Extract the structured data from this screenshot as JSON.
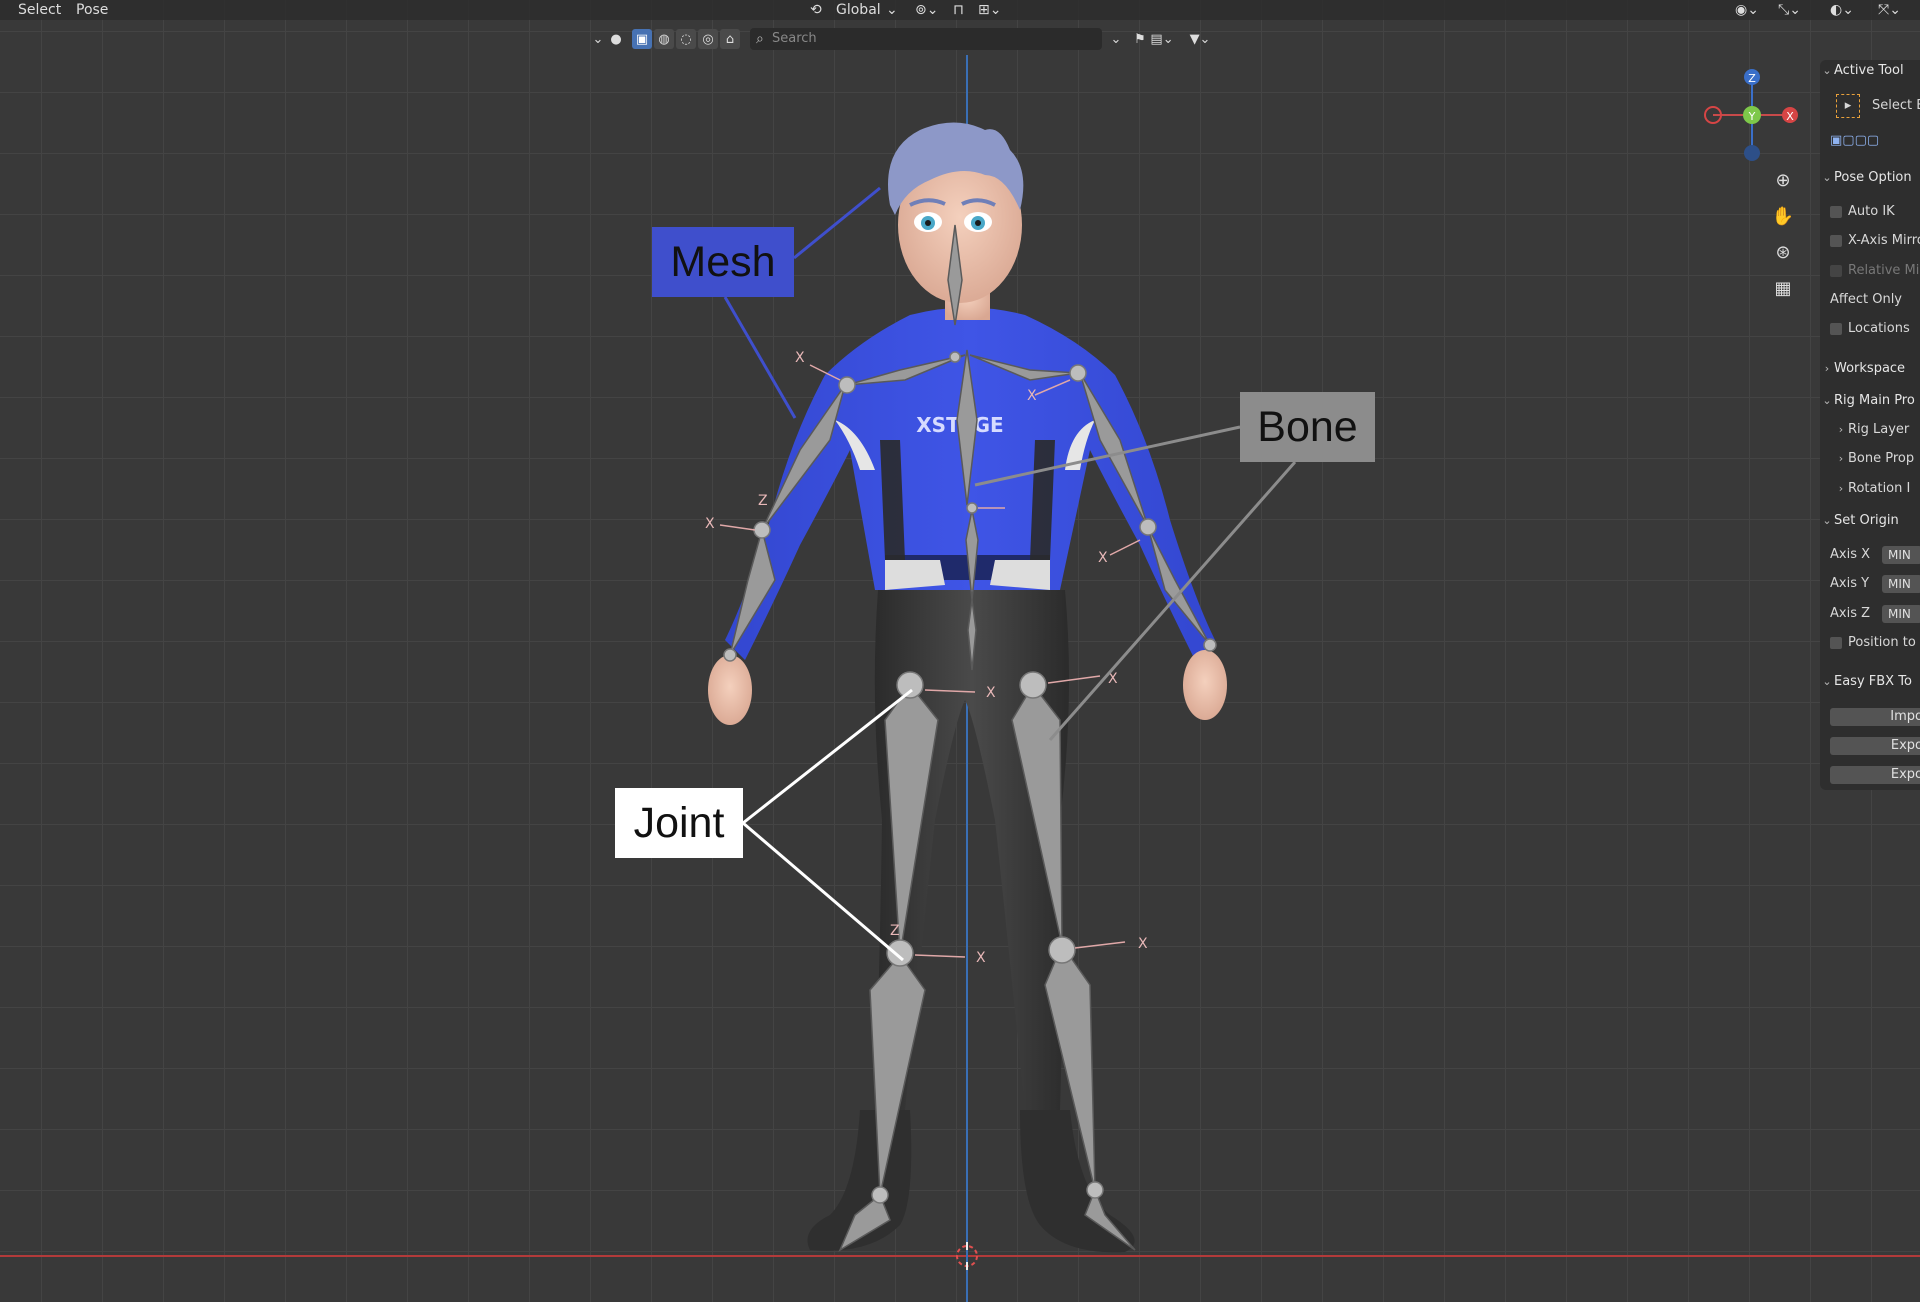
{
  "menubar": {
    "items": [
      "Select",
      "Pose"
    ],
    "transform_orientation": "Global"
  },
  "toolbar": {
    "search_placeholder": "Search"
  },
  "annotations": {
    "mesh": "Mesh",
    "bone": "Bone",
    "joint": "Joint"
  },
  "viewport": {
    "shirt_logo": "XSTAGE",
    "gizmo": {
      "z": "Z",
      "y": "Y",
      "x": "X"
    },
    "bone_axis_x": "X",
    "bone_axis_z": "Z"
  },
  "sidepanel": {
    "active_tool_header": "Active Tool",
    "active_tool_item": "Select B",
    "pose_options_header": "Pose Option",
    "auto_ik": "Auto IK",
    "x_axis_mirror": "X-Axis Mirro",
    "relative_mirror": "Relative Mir",
    "affect_only": "Affect Only",
    "locations": "Locations",
    "workspace": "Workspace",
    "rig_main_header": "Rig Main Pro",
    "rig_layers": "Rig Layer",
    "bone_props": "Bone Prop",
    "rotation": "Rotation I",
    "set_origin_header": "Set Origin",
    "axis_x": "Axis X",
    "axis_y": "Axis Y",
    "axis_z": "Axis Z",
    "axis_value": "MIN",
    "position_to": "Position to C",
    "easy_fbx_header": "Easy FBX To",
    "import_btn": "Impo",
    "export_btn_1": "Expo",
    "export_btn_2": "Expo"
  }
}
